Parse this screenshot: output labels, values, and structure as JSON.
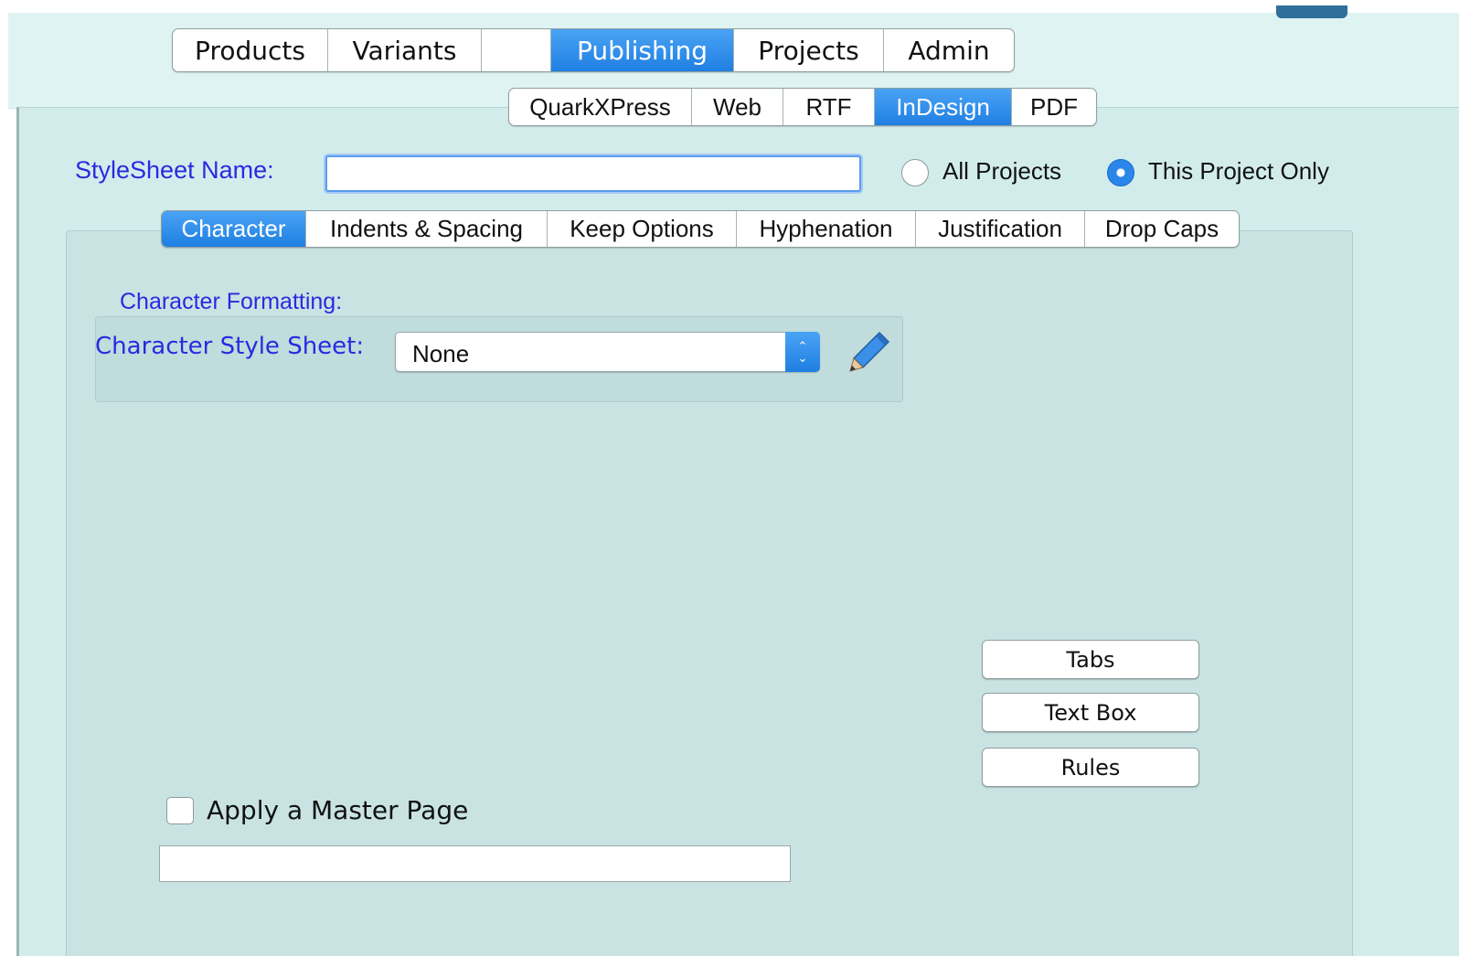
{
  "main_tabs": [
    {
      "label": "Products",
      "active": false
    },
    {
      "label": "Variants",
      "active": false
    },
    {
      "label": "",
      "active": false
    },
    {
      "label": "Publishing",
      "active": true
    },
    {
      "label": "Projects",
      "active": false
    },
    {
      "label": "Admin",
      "active": false
    }
  ],
  "sub_tabs": [
    {
      "label": "QuarkXPress",
      "active": false
    },
    {
      "label": "Web",
      "active": false
    },
    {
      "label": "RTF",
      "active": false
    },
    {
      "label": "InDesign",
      "active": true
    },
    {
      "label": "PDF",
      "active": false
    }
  ],
  "stylesheet": {
    "name_label": "StyleSheet Name:",
    "name_value": "",
    "scope_options": [
      {
        "label": "All Projects",
        "selected": false
      },
      {
        "label": "This Project Only",
        "selected": true
      }
    ]
  },
  "inner_tabs": [
    {
      "label": "Character",
      "active": true
    },
    {
      "label": "Indents & Spacing",
      "active": false
    },
    {
      "label": "Keep Options",
      "active": false
    },
    {
      "label": "Hyphenation",
      "active": false
    },
    {
      "label": "Justification",
      "active": false
    },
    {
      "label": "Drop Caps",
      "active": false
    }
  ],
  "character": {
    "section_label": "Character Formatting:",
    "style_sheet_label": "Character Style Sheet:",
    "style_sheet_value": "None",
    "edit_icon": "pencil-icon"
  },
  "side_buttons": {
    "tabs": "Tabs",
    "text_box": "Text Box",
    "rules": "Rules"
  },
  "master_page": {
    "checkbox_label": "Apply a Master Page",
    "checked": false,
    "value": ""
  },
  "colors": {
    "accent": "#1f7fe2",
    "label_blue": "#2a2ae0",
    "panel_bg": "#d2ecec",
    "inner_bg": "#c9e3e3"
  }
}
